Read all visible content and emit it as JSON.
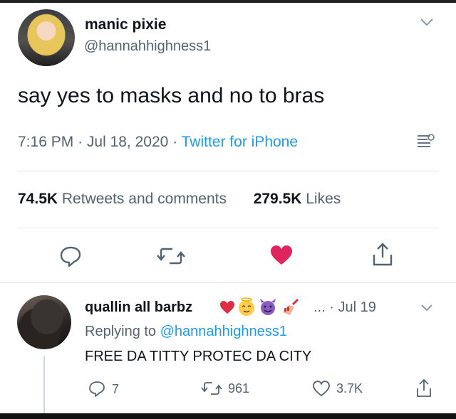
{
  "tweet": {
    "display_name": "manic pixie",
    "handle": "@hannahhighness1",
    "text": "say yes to masks and no to bras",
    "time": "7:16 PM",
    "date": "Jul 18, 2020",
    "source": "Twitter for iPhone",
    "retweets_count": "74.5K",
    "retweets_label": "Retweets and comments",
    "likes_count": "279.5K",
    "likes_label": "Likes"
  },
  "reply": {
    "display_name": "quallin all barbz",
    "ellipsis": "...",
    "date": "Jul 19",
    "replying_prefix": "Replying to ",
    "replying_handle": "@hannahhighness1",
    "text": "FREE DA TITTY PROTEC DA CITY",
    "reply_count": "7",
    "retweet_count": "961",
    "like_count": "3.7K"
  },
  "colors": {
    "like_active": "#f91880",
    "link": "#1d9bf0",
    "secondary_text": "#536471"
  },
  "icons": [
    "chevron-down-icon",
    "analytics-icon",
    "reply-icon",
    "retweet-icon",
    "heart-icon",
    "share-icon"
  ]
}
